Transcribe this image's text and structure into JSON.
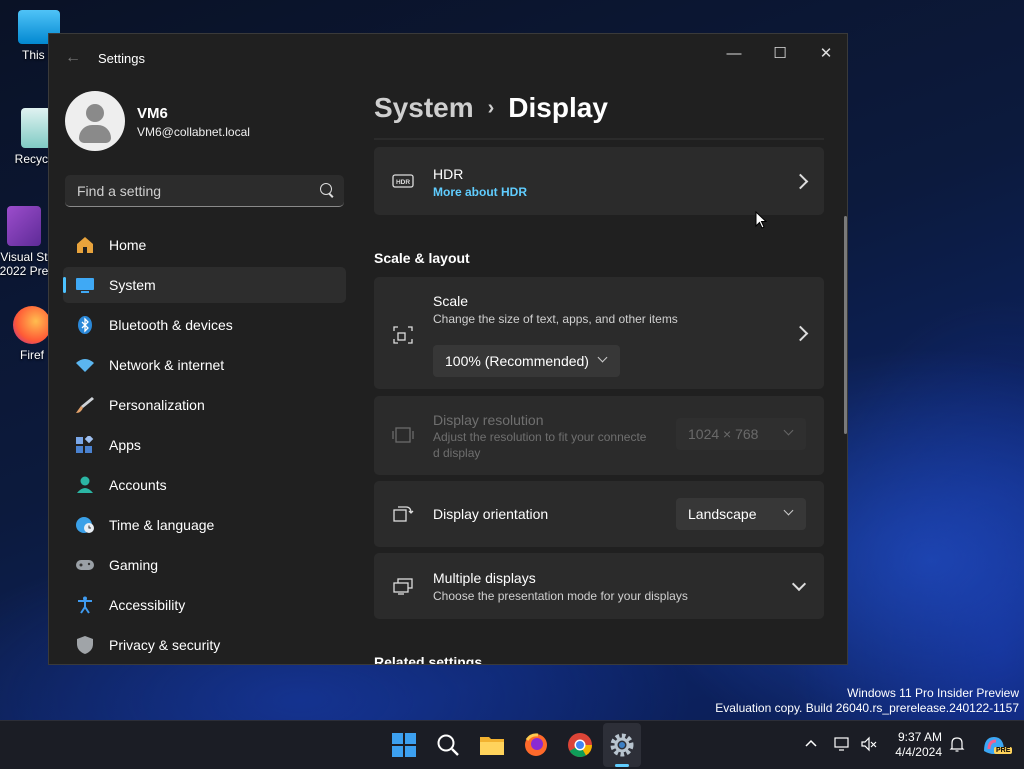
{
  "desktop": {
    "icons": [
      {
        "label": "This P"
      },
      {
        "label": "Recycle"
      },
      {
        "label": "Visual St 2022 Pre"
      },
      {
        "label": "Firef"
      }
    ],
    "watermark_line1": "Windows 11 Pro Insider Preview",
    "watermark_line2": "Evaluation copy. Build 26040.rs_prerelease.240122-1157"
  },
  "window": {
    "title": "Settings",
    "minimize_glyph": "—",
    "maximize_glyph": "☐",
    "close_glyph": "✕",
    "back_glyph": "←"
  },
  "user": {
    "name": "VM6",
    "email": "VM6@collabnet.local"
  },
  "search": {
    "placeholder": "Find a setting"
  },
  "nav": {
    "items": [
      {
        "label": "Home",
        "icon": "home-icon",
        "color": "#e8a33c"
      },
      {
        "label": "System",
        "icon": "system-icon",
        "color": "#3fa9f5",
        "active": true
      },
      {
        "label": "Bluetooth & devices",
        "icon": "bluetooth-icon",
        "color": "#2b88d8"
      },
      {
        "label": "Network & internet",
        "icon": "wifi-icon",
        "color": "#5bb6f0"
      },
      {
        "label": "Personalization",
        "icon": "brush-icon",
        "color": "#e3a26b"
      },
      {
        "label": "Apps",
        "icon": "apps-icon",
        "color": "#7aa7e8"
      },
      {
        "label": "Accounts",
        "icon": "accounts-icon",
        "color": "#2bb6a4"
      },
      {
        "label": "Time & language",
        "icon": "globe-clock-icon",
        "color": "#3aa0e8"
      },
      {
        "label": "Gaming",
        "icon": "gamepad-icon",
        "color": "#9aa0a6"
      },
      {
        "label": "Accessibility",
        "icon": "accessibility-icon",
        "color": "#3f9bf0"
      },
      {
        "label": "Privacy & security",
        "icon": "shield-icon",
        "color": "#a0a4a8"
      }
    ]
  },
  "breadcrumb": {
    "parent": "System",
    "separator": "›",
    "current": "Display"
  },
  "hdr": {
    "title": "HDR",
    "link": "More about HDR",
    "link_color": "#60cdff"
  },
  "scale_layout": {
    "heading": "Scale & layout",
    "scale": {
      "title": "Scale",
      "subtitle": "Change the size of text, apps, and other items",
      "value": "100% (Recommended)"
    },
    "resolution": {
      "title": "Display resolution",
      "subtitle_line1": "Adjust the resolution to fit your connecte",
      "subtitle_line2": "d display",
      "value": "1024 × 768"
    },
    "orientation": {
      "title": "Display orientation",
      "value": "Landscape"
    },
    "multiple": {
      "title": "Multiple displays",
      "subtitle": "Choose the presentation mode for your displays"
    }
  },
  "related": {
    "heading": "Related settings"
  },
  "taskbar": {
    "apps": [
      "start-icon",
      "search-icon",
      "file-explorer-icon",
      "firefox-icon",
      "chrome-icon",
      "settings-icon"
    ],
    "time": "9:37 AM",
    "date": "4/4/2024",
    "badge": "PRE"
  }
}
